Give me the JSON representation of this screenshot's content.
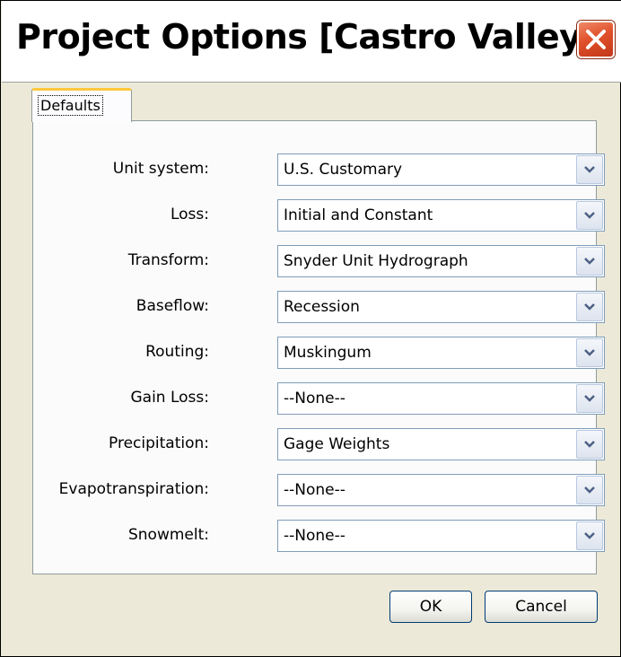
{
  "window": {
    "title": "Project Options [Castro Valley]",
    "close_icon": "close-icon"
  },
  "tabs": [
    {
      "label": "Defaults",
      "selected": true
    }
  ],
  "fields": [
    {
      "label": "Unit system:",
      "value": "U.S. Customary"
    },
    {
      "label": "Loss:",
      "value": "Initial and Constant"
    },
    {
      "label": "Transform:",
      "value": "Snyder Unit Hydrograph"
    },
    {
      "label": "Baseflow:",
      "value": "Recession"
    },
    {
      "label": "Routing:",
      "value": "Muskingum"
    },
    {
      "label": "Gain Loss:",
      "value": "--None--"
    },
    {
      "label": "Precipitation:",
      "value": "Gage Weights"
    },
    {
      "label": "Evapotranspiration:",
      "value": "--None--"
    },
    {
      "label": "Snowmelt:",
      "value": "--None--"
    }
  ],
  "buttons": {
    "ok_label": "OK",
    "cancel_label": "Cancel"
  },
  "colors": {
    "close_button": "#e0502a",
    "tab_highlight": "#ffc83c",
    "dialog_background": "#ece9d8",
    "field_border": "#7f9db9"
  }
}
